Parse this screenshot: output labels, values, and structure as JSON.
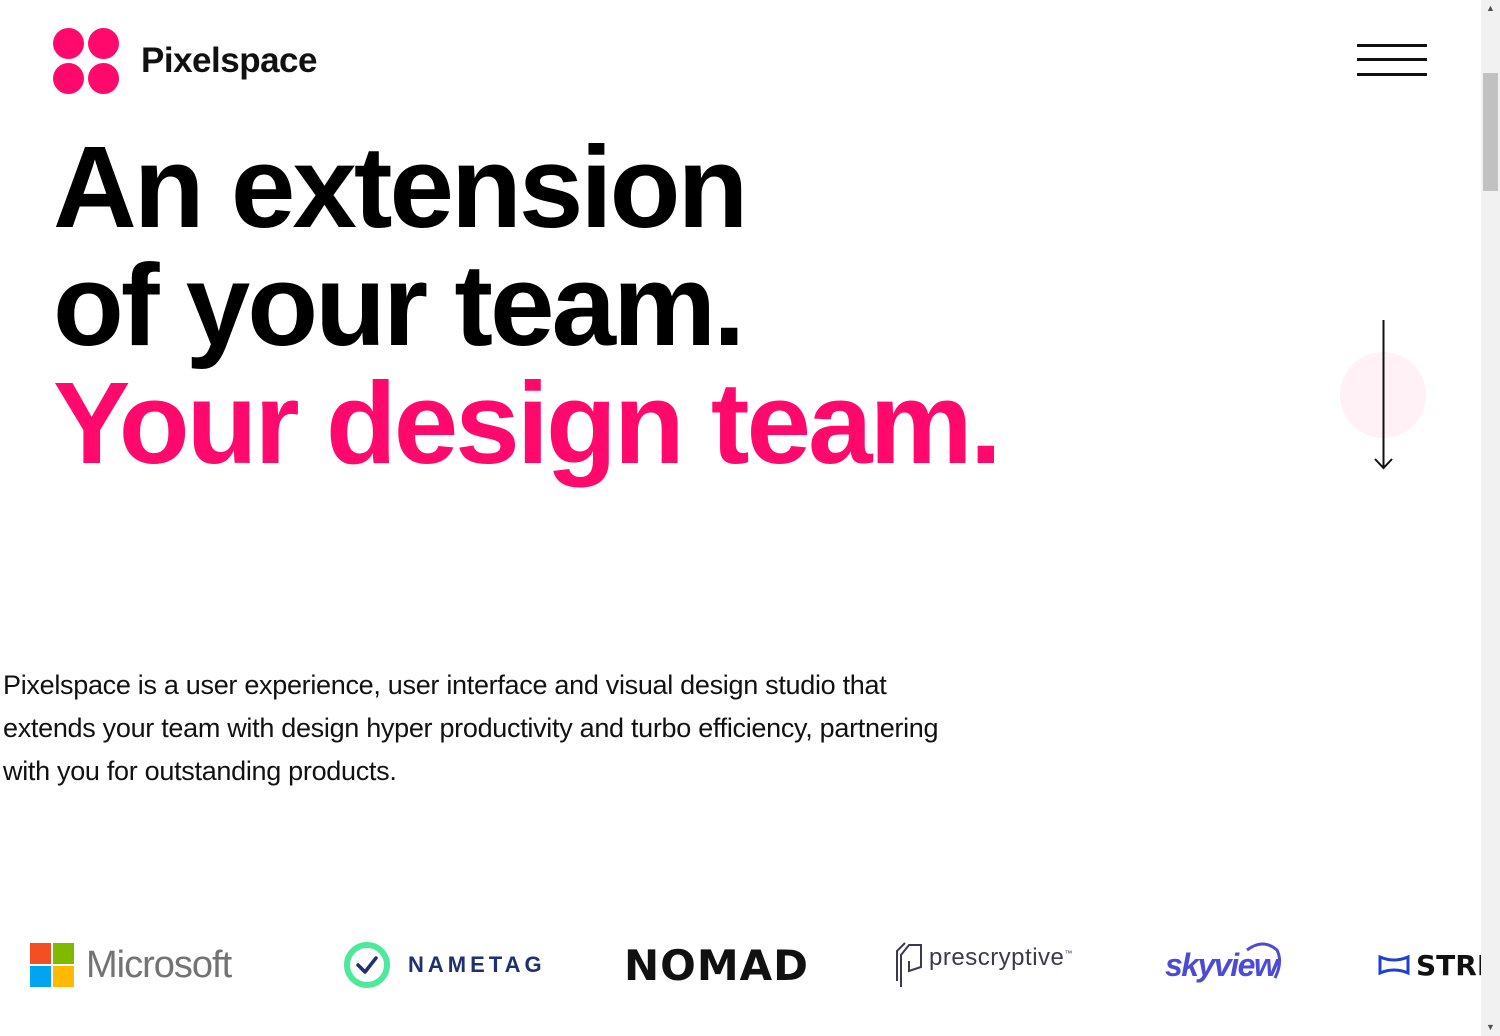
{
  "brand": {
    "name": "Pixelspace",
    "logo_icon": "four-dots-logo-icon",
    "accent_color": "#ff0a6c"
  },
  "header": {
    "menu_icon": "hamburger-menu-icon"
  },
  "hero": {
    "line1": "An extension",
    "line2": "of your team.",
    "line3": "Your design team.",
    "scroll_icon": "arrow-down-icon"
  },
  "intro": {
    "text": "Pixelspace is a user experience, user interface and visual design studio that extends your team with design hyper productivity and turbo efficiency, partnering with you for outstanding products."
  },
  "clients": {
    "microsoft": "Microsoft",
    "nametag": "NAMETAG",
    "nomad": "NOMAD",
    "prescryptive": "prescryptive",
    "prescryptive_tm": "™",
    "skyview": "skyview",
    "stri": "STRI"
  },
  "colors": {
    "ms_red": "#f25022",
    "ms_green": "#7fba00",
    "ms_blue": "#00a4ef",
    "ms_yellow": "#ffb900",
    "nametag_green": "#4de89a",
    "nametag_navy": "#1f2f6f",
    "skyview_blue": "#4b4bd6"
  }
}
